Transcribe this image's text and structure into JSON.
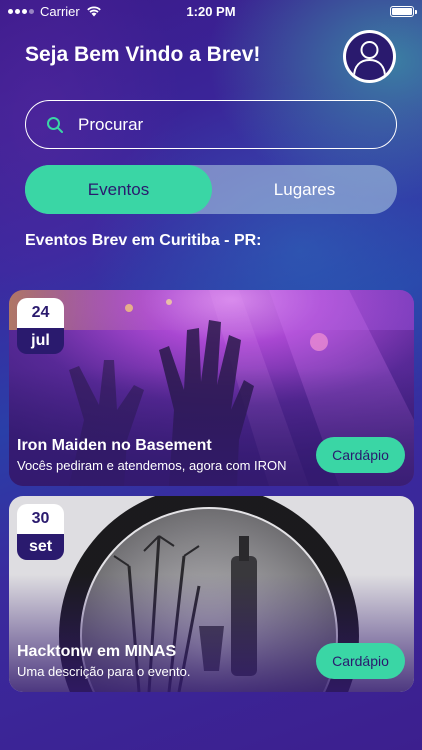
{
  "status_bar": {
    "carrier": "Carrier",
    "time": "1:20 PM"
  },
  "header": {
    "welcome": "Seja Bem Vindo a Brev!"
  },
  "search": {
    "placeholder": "Procurar"
  },
  "segment": {
    "tab_events": "Eventos",
    "tab_places": "Lugares",
    "active": "Eventos"
  },
  "section": {
    "title": "Eventos Brev em Curitiba - PR:"
  },
  "events": [
    {
      "day": "24",
      "month": "jul",
      "title": "Iron Maiden no Basement",
      "description": "Vocês pediram e atendemos, agora com IRON",
      "button": "Cardápio"
    },
    {
      "day": "30",
      "month": "set",
      "title": "Hacktonw em MINAS",
      "description": "Uma descrição para o evento.",
      "button": "Cardápio"
    }
  ],
  "colors": {
    "accent": "#3ad6a5",
    "dark": "#2a1a6e"
  }
}
